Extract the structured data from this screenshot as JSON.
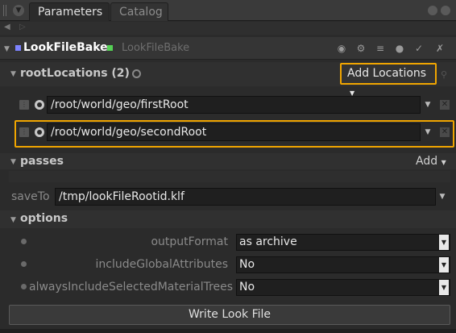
{
  "tabs": [
    {
      "label": "Parameters",
      "active": true
    },
    {
      "label": "Catalog",
      "active": false
    }
  ],
  "node": {
    "name": "LookFileBake",
    "type_label": "LookFileBake",
    "name_color": "#7d83ff",
    "state_color": "#55d055"
  },
  "root_locations": {
    "title": "rootLocations (2)",
    "add_label": "Add Locations",
    "items": [
      {
        "path": "/root/world/geo/firstRoot",
        "highlighted": false
      },
      {
        "path": "/root/world/geo/secondRoot",
        "highlighted": true
      }
    ]
  },
  "passes": {
    "title": "passes",
    "add_label": "Add"
  },
  "save_to": {
    "label": "saveTo",
    "value": "/tmp/lookFileRootid.klf"
  },
  "options": {
    "title": "options",
    "fields": [
      {
        "label": "outputFormat",
        "value": "as archive"
      },
      {
        "label": "includeGlobalAttributes",
        "value": "No"
      },
      {
        "label": "alwaysIncludeSelectedMaterialTrees",
        "value": "No"
      }
    ]
  },
  "write_button_label": "Write Look File",
  "highlight_color": "#f0a500"
}
